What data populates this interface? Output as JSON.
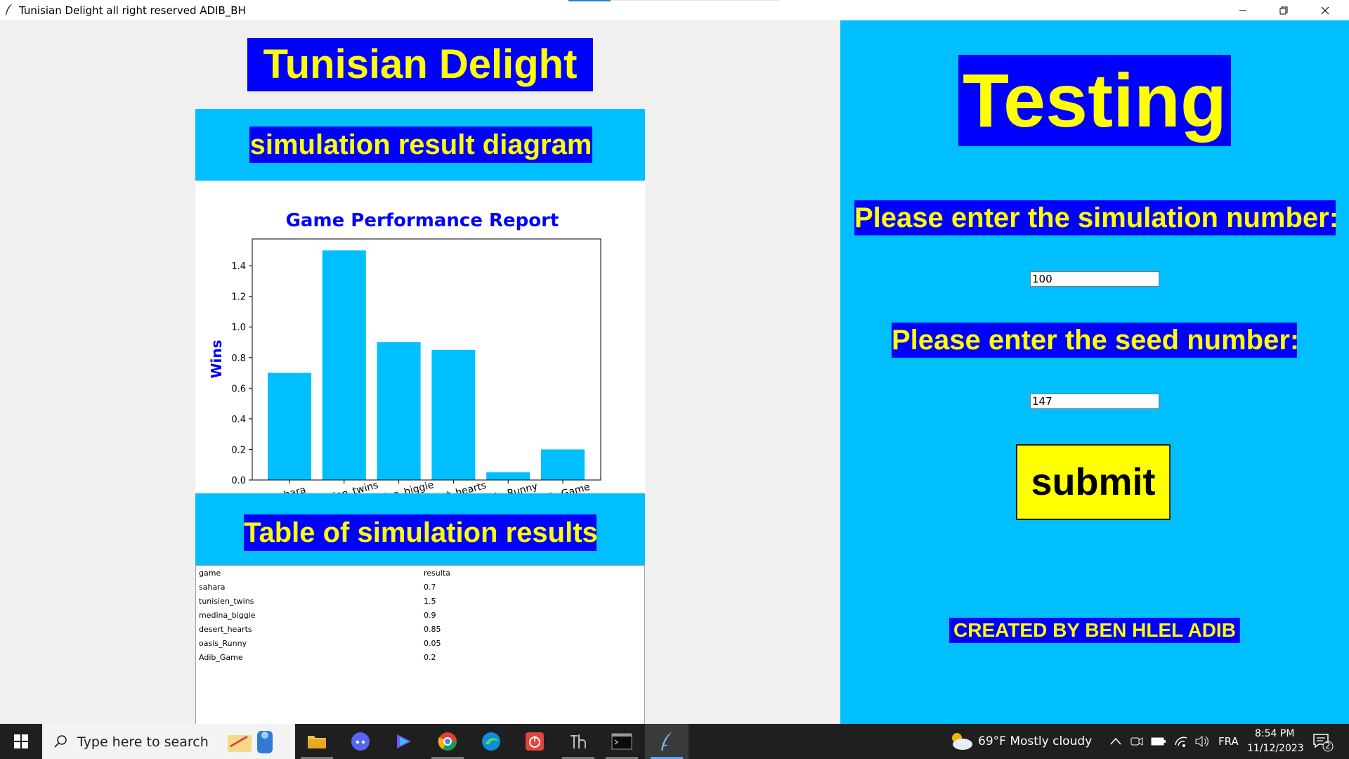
{
  "window": {
    "title": "Tunisian Delight all right reserved ADIB_BH"
  },
  "left": {
    "app_title": "Tunisian Delight",
    "diagram_label": "simulation result diagram",
    "table_label": "Table of simulation results"
  },
  "chart_data": {
    "type": "bar",
    "title": "Game Performance Report",
    "xlabel": "",
    "ylabel": "Wins",
    "categories": [
      "sahara",
      "tunisien_twins",
      "medina_biggie",
      "desert_hearts",
      "oasis_Runny",
      "Adib_Game"
    ],
    "values": [
      0.7,
      1.5,
      0.9,
      0.85,
      0.05,
      0.2
    ],
    "ylim": [
      0,
      1.575
    ],
    "yticks": [
      "0.0",
      "0.2",
      "0.4",
      "0.6",
      "0.8",
      "1.0",
      "1.2",
      "1.4"
    ],
    "bar_color": "#00bfff",
    "title_color": "#0000ff",
    "grid": false
  },
  "table": {
    "headers": [
      "game",
      "resulta"
    ],
    "rows": [
      [
        "sahara",
        "0.7"
      ],
      [
        "tunisien_twins",
        "1.5"
      ],
      [
        "medina_biggie",
        "0.9"
      ],
      [
        "desert_hearts",
        "0.85"
      ],
      [
        "oasis_Runny",
        "0.05"
      ],
      [
        "Adib_Game",
        "0.2"
      ]
    ]
  },
  "right": {
    "title": "Testing",
    "sim_prompt": "Please enter the simulation number:",
    "sim_value": "100",
    "seed_prompt": "Please enter the seed number:",
    "seed_value": "147",
    "submit_label": "submit",
    "credit": "CREATED BY BEN HLEL ADIB"
  },
  "taskbar": {
    "search_placeholder": "Type here to search",
    "weather": "69°F  Mostly cloudy",
    "language": "FRA",
    "time": "8:54 PM",
    "date": "11/12/2023",
    "notification_count": "2",
    "icons": [
      "file-explorer-icon",
      "discord-icon",
      "edit-app-icon",
      "chrome-icon",
      "edge-icon",
      "power-app-icon",
      "th-app-icon",
      "terminal-icon",
      "python-feather-icon"
    ]
  },
  "colors": {
    "cyan": "#00bfff",
    "blue": "#0000ff",
    "yellow": "#ffff00"
  }
}
